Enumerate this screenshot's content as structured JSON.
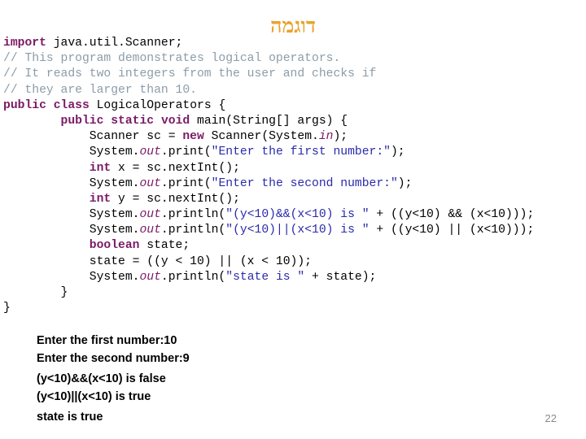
{
  "slide": {
    "title": "דוגמה",
    "title_color": "#E8A32D",
    "page_number": "22"
  },
  "theme": {
    "background": "#FFFFFF",
    "keyword_color": "#7B1A66",
    "comment_color": "#8C9CA8",
    "string_color": "#2A2AAB",
    "field_color": "#7B1A66",
    "plain_color": "#000000",
    "page_number_color": "#8A8A8A"
  },
  "code": {
    "language": "java",
    "lines": [
      [
        {
          "t": "import",
          "c": "kw"
        },
        {
          "t": " java.util.Scanner;",
          "c": "pln"
        }
      ],
      [
        {
          "t": "// This program demonstrates logical operators.",
          "c": "cmt"
        }
      ],
      [
        {
          "t": "// It reads two integers from the user and checks if",
          "c": "cmt"
        }
      ],
      [
        {
          "t": "// they are larger than 10.",
          "c": "cmt"
        }
      ],
      [
        {
          "t": "public",
          "c": "kw"
        },
        {
          "t": " ",
          "c": "pln"
        },
        {
          "t": "class",
          "c": "kw"
        },
        {
          "t": " LogicalOperators {",
          "c": "pln"
        }
      ],
      [
        {
          "t": "        ",
          "c": "pln"
        },
        {
          "t": "public",
          "c": "kw"
        },
        {
          "t": " ",
          "c": "pln"
        },
        {
          "t": "static",
          "c": "kw"
        },
        {
          "t": " ",
          "c": "pln"
        },
        {
          "t": "void",
          "c": "kw"
        },
        {
          "t": " main(String[] args) {",
          "c": "pln"
        }
      ],
      [
        {
          "t": "            Scanner sc = ",
          "c": "pln"
        },
        {
          "t": "new",
          "c": "kw"
        },
        {
          "t": " Scanner(System.",
          "c": "pln"
        },
        {
          "t": "in",
          "c": "fld"
        },
        {
          "t": ");",
          "c": "pln"
        }
      ],
      [
        {
          "t": "            System.",
          "c": "pln"
        },
        {
          "t": "out",
          "c": "fld"
        },
        {
          "t": ".print(",
          "c": "pln"
        },
        {
          "t": "\"Enter the first number:\"",
          "c": "str"
        },
        {
          "t": ");",
          "c": "pln"
        }
      ],
      [
        {
          "t": "            ",
          "c": "pln"
        },
        {
          "t": "int",
          "c": "kw"
        },
        {
          "t": " x = sc.nextInt();",
          "c": "pln"
        }
      ],
      [
        {
          "t": "            System.",
          "c": "pln"
        },
        {
          "t": "out",
          "c": "fld"
        },
        {
          "t": ".print(",
          "c": "pln"
        },
        {
          "t": "\"Enter the second number:\"",
          "c": "str"
        },
        {
          "t": ");",
          "c": "pln"
        }
      ],
      [
        {
          "t": "            ",
          "c": "pln"
        },
        {
          "t": "int",
          "c": "kw"
        },
        {
          "t": " y = sc.nextInt();",
          "c": "pln"
        }
      ],
      [
        {
          "t": "            System.",
          "c": "pln"
        },
        {
          "t": "out",
          "c": "fld"
        },
        {
          "t": ".println(",
          "c": "pln"
        },
        {
          "t": "\"(y<10)&&(x<10) is \"",
          "c": "str"
        },
        {
          "t": " + ((y<10) && (x<10)));",
          "c": "pln"
        }
      ],
      [
        {
          "t": "            System.",
          "c": "pln"
        },
        {
          "t": "out",
          "c": "fld"
        },
        {
          "t": ".println(",
          "c": "pln"
        },
        {
          "t": "\"(y<10)||(x<10) is \"",
          "c": "str"
        },
        {
          "t": " + ((y<10) || (x<10)));",
          "c": "pln"
        }
      ],
      [
        {
          "t": "            ",
          "c": "pln"
        },
        {
          "t": "boolean",
          "c": "kw"
        },
        {
          "t": " state;",
          "c": "pln"
        }
      ],
      [
        {
          "t": "            state = ((y < 10) || (x < 10));",
          "c": "pln"
        }
      ],
      [
        {
          "t": "            System.",
          "c": "pln"
        },
        {
          "t": "out",
          "c": "fld"
        },
        {
          "t": ".println(",
          "c": "pln"
        },
        {
          "t": "\"state is \"",
          "c": "str"
        },
        {
          "t": " + state);",
          "c": "pln"
        }
      ],
      [
        {
          "t": "        }",
          "c": "pln"
        }
      ],
      [
        {
          "t": "}",
          "c": "pln"
        }
      ]
    ]
  },
  "console": {
    "lines": [
      {
        "text": "Enter the first number:10",
        "spaced": false
      },
      {
        "text": "Enter the second number:9",
        "spaced": false
      },
      {
        "text": "(y<10)&&(x<10) is false",
        "spaced": true
      },
      {
        "text": "(y<10)||(x<10) is true",
        "spaced": false
      },
      {
        "text": "state is true",
        "spaced": true
      }
    ]
  }
}
